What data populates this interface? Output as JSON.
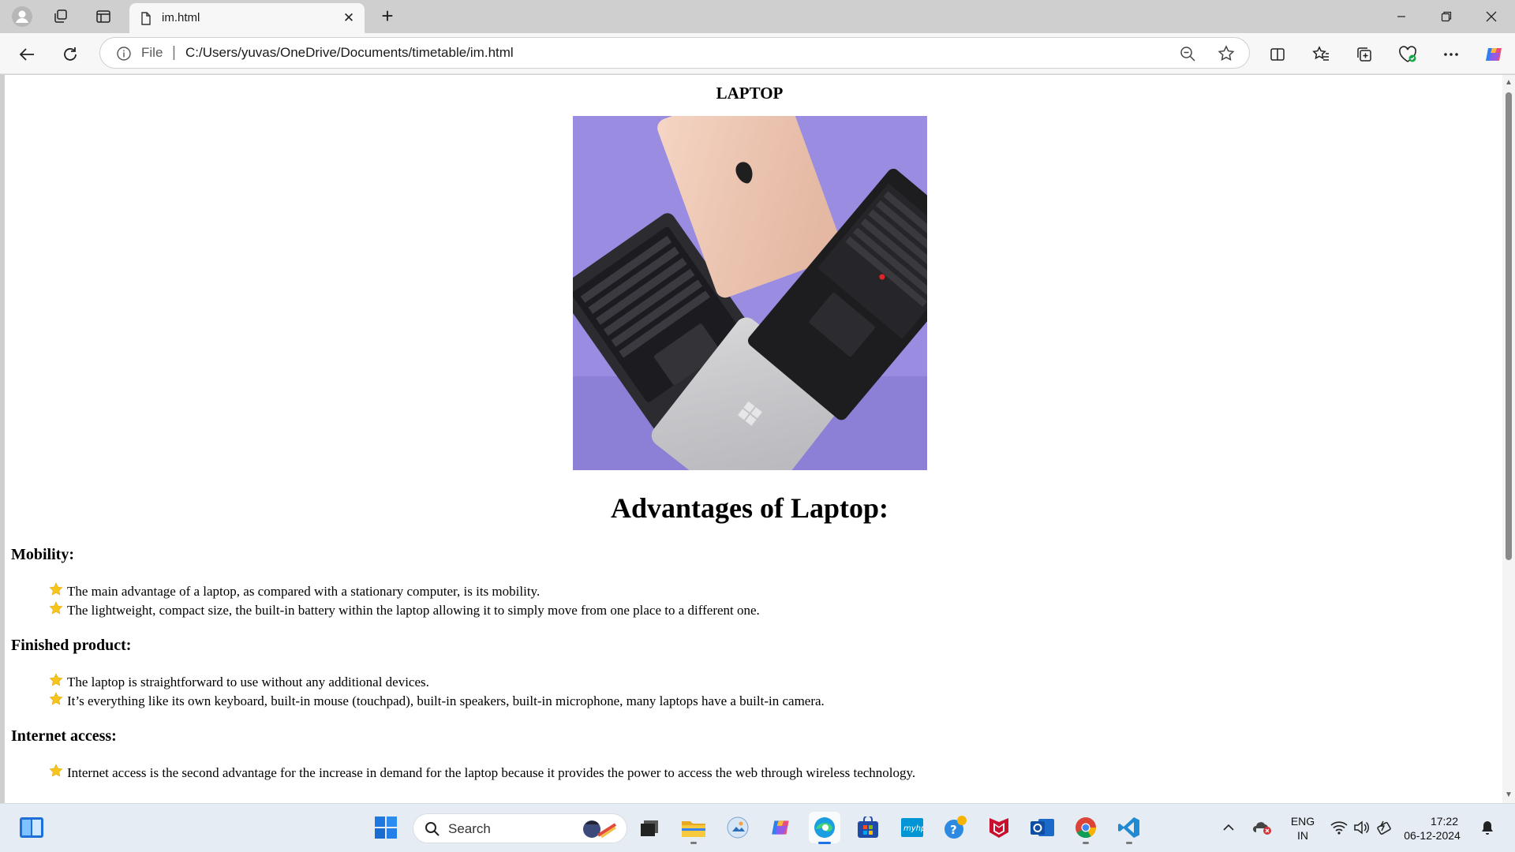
{
  "browser": {
    "tab_title": "im.html",
    "address_scheme": "File",
    "address_url": "C:/Users/yuvas/OneDrive/Documents/timetable/im.html"
  },
  "page": {
    "heading": "LAPTOP",
    "subheading": "Advantages of Laptop:",
    "sections": [
      {
        "title": "Mobility:",
        "items": [
          "The main advantage of a laptop, as compared with a stationary computer, is its mobility.",
          "The lightweight, compact size, the built-in battery within the laptop allowing it to simply move from one place to a different one."
        ]
      },
      {
        "title": "Finished product:",
        "items": [
          "The laptop is straightforward to use without any additional devices.",
          "It’s everything like its own keyboard, built-in mouse (touchpad), built-in speakers, built-in microphone, many laptops have a built-in camera."
        ]
      },
      {
        "title": "Internet access:",
        "items": [
          "Internet access is the second advantage for the increase in demand for the laptop because it provides the power to access the web through wireless technology."
        ]
      }
    ]
  },
  "taskbar": {
    "search_label": "Search",
    "language_top": "ENG",
    "language_bottom": "IN",
    "time": "17:22",
    "date": "06-12-2024"
  },
  "colors": {
    "image_background": "#9a8ce0",
    "edge_accent": "#1a73e8",
    "bullet_star": "#f6c51b"
  }
}
